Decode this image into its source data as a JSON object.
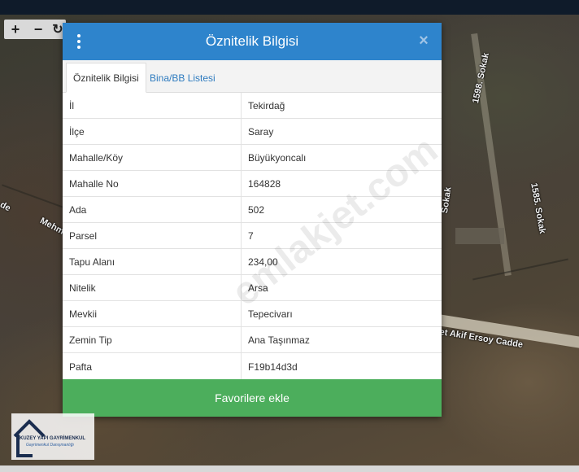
{
  "map": {
    "road_labels": [
      "1598. Sokak",
      "Sokak",
      "1585. Sokak",
      "Mehm",
      "de",
      "et Akif Ersoy Cadde"
    ]
  },
  "zoom": {
    "zoom_in": "+",
    "zoom_out": "−",
    "rotate": "↻"
  },
  "dialog": {
    "title": "Öznitelik Bilgisi",
    "close": "×",
    "tabs": [
      "Öznitelik Bilgisi",
      "Bina/BB Listesi"
    ],
    "rows": [
      {
        "key": "İl",
        "value": "Tekirdağ"
      },
      {
        "key": "İlçe",
        "value": "Saray"
      },
      {
        "key": "Mahalle/Köy",
        "value": "Büyükyoncalı"
      },
      {
        "key": "Mahalle No",
        "value": "164828"
      },
      {
        "key": "Ada",
        "value": "502"
      },
      {
        "key": "Parsel",
        "value": "7"
      },
      {
        "key": "Tapu Alanı",
        "value": "234,00"
      },
      {
        "key": "Nitelik",
        "value": "Arsa"
      },
      {
        "key": "Mevkii",
        "value": "Tepecivarı"
      },
      {
        "key": "Zemin Tip",
        "value": "Ana Taşınmaz"
      },
      {
        "key": "Pafta",
        "value": "F19b14d3d"
      }
    ],
    "favorite_button": "Favorilere ekle"
  },
  "watermark": "emlakjet.com",
  "logo": {
    "name": "KUZEY YAPI GAYRİMENKUL",
    "tagline": "Gayrimenkul Danışmanlığı"
  },
  "colors": {
    "header": "#2e84cc",
    "favorite_button": "#4cae5c",
    "tab_link": "#2e7bbf"
  }
}
